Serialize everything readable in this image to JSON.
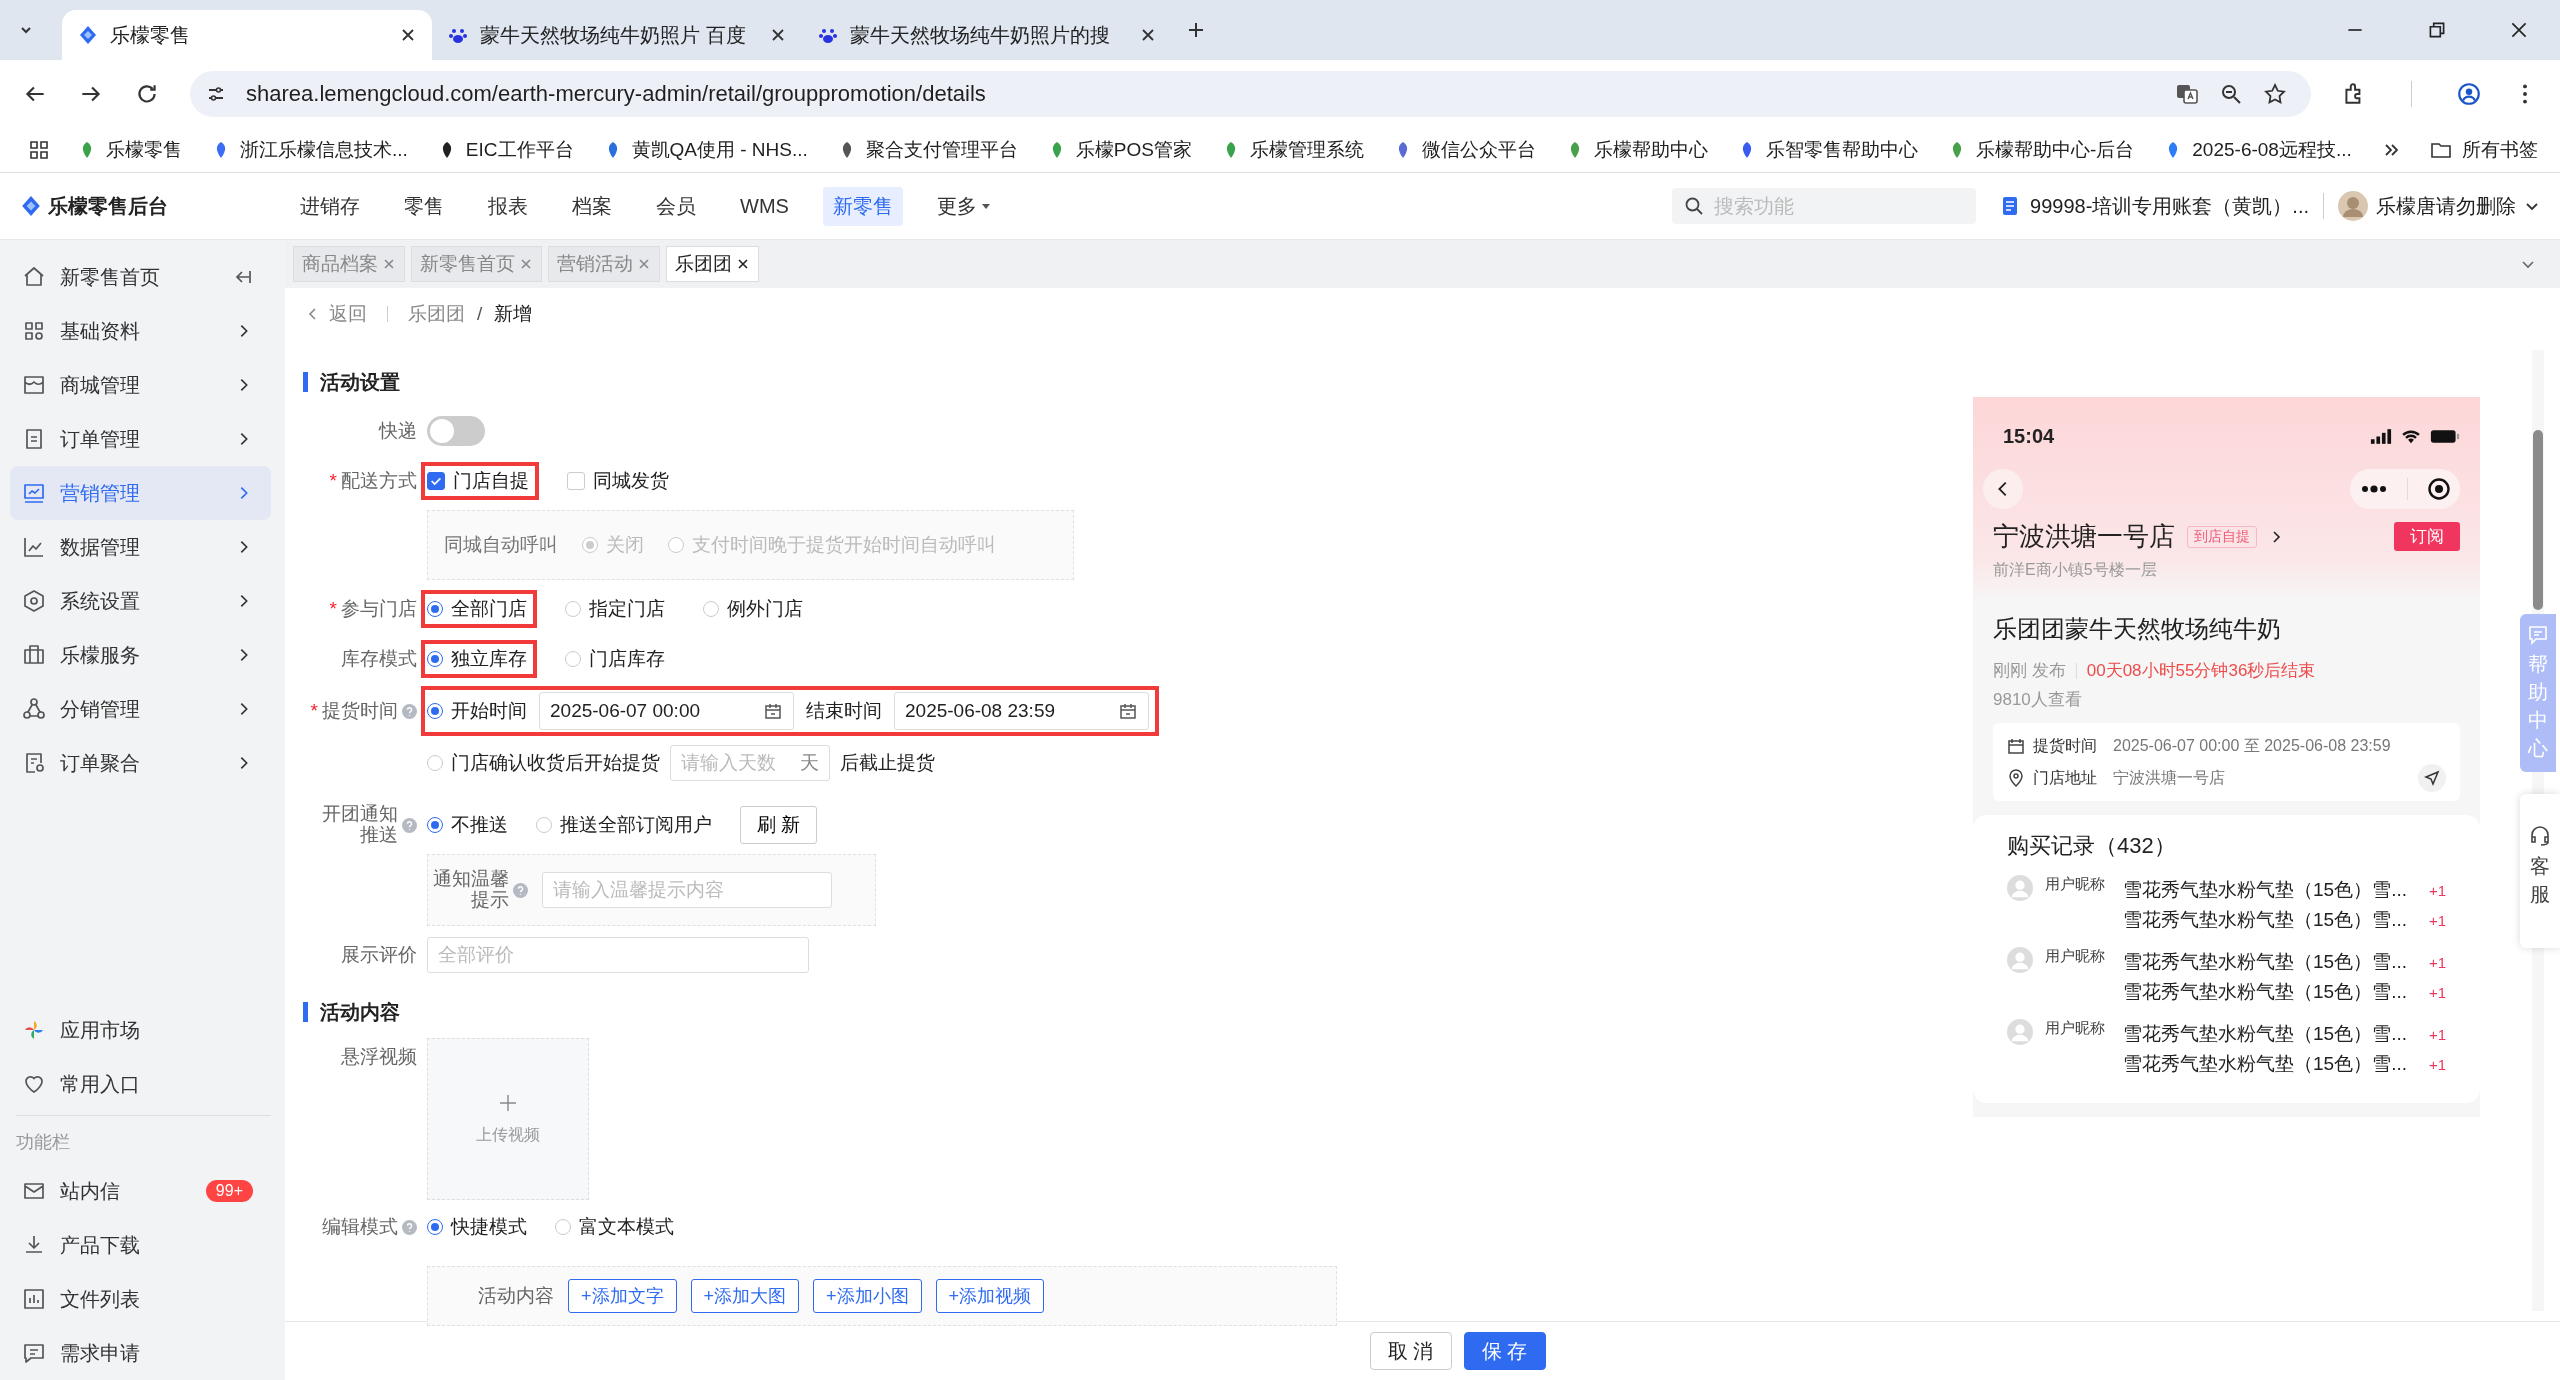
{
  "browser": {
    "tabs": [
      {
        "title": "乐檬零售",
        "selected": true
      },
      {
        "title": "蒙牛天然牧场纯牛奶照片 百度",
        "selected": false
      },
      {
        "title": "蒙牛天然牧场纯牛奶照片的搜",
        "selected": false
      }
    ],
    "url": "sharea.lemengcloud.com/earth-mercury-admin/retail/grouppromotion/details",
    "bookmarks": [
      "乐檬零售",
      "浙江乐檬信息技术...",
      "EIC工作平台",
      "黄凯QA使用 - NHS...",
      "聚合支付管理平台",
      "乐檬POS管家",
      "乐檬管理系统",
      "微信公众平台",
      "乐檬帮助中心",
      "乐智零售帮助中心",
      "乐檬帮助中心-后台",
      "2025-6-08远程技..."
    ],
    "all_bookmarks": "所有书签"
  },
  "app": {
    "brand": "乐檬零售后台",
    "nav": [
      {
        "label": "进销存",
        "selected": false
      },
      {
        "label": "零售",
        "selected": false
      },
      {
        "label": "报表",
        "selected": false
      },
      {
        "label": "档案",
        "selected": false
      },
      {
        "label": "会员",
        "selected": false
      },
      {
        "label": "WMS",
        "selected": false
      },
      {
        "label": "新零售",
        "selected": true
      },
      {
        "label": "更多",
        "selected": false
      }
    ],
    "search_placeholder": "搜索功能",
    "account": "99998-培训专用账套（黄凯）...",
    "user": "乐檬唐请勿删除"
  },
  "sidebar": {
    "items": [
      {
        "label": "新零售首页",
        "selected": false
      },
      {
        "label": "基础资料",
        "selected": false
      },
      {
        "label": "商城管理",
        "selected": false
      },
      {
        "label": "订单管理",
        "selected": false
      },
      {
        "label": "营销管理",
        "selected": true
      },
      {
        "label": "数据管理",
        "selected": false
      },
      {
        "label": "系统设置",
        "selected": false
      },
      {
        "label": "乐檬服务",
        "selected": false
      },
      {
        "label": "分销管理",
        "selected": false
      },
      {
        "label": "订单聚合",
        "selected": false
      }
    ],
    "shortcuts": [
      "应用市场",
      "常用入口"
    ],
    "section": "功能栏",
    "tools": [
      {
        "label": "站内信",
        "badge": "99+"
      },
      {
        "label": "产品下载"
      },
      {
        "label": "文件列表"
      },
      {
        "label": "需求申请"
      }
    ]
  },
  "page_tabs": [
    {
      "label": "商品档案",
      "selected": false
    },
    {
      "label": "新零售首页",
      "selected": false
    },
    {
      "label": "营销活动",
      "selected": false
    },
    {
      "label": "乐团团",
      "selected": true
    }
  ],
  "breadcrumb": {
    "back": "返回",
    "path": [
      "乐团团",
      "新增"
    ],
    "separator": "/"
  },
  "settings": {
    "title": "活动设置",
    "express": {
      "label": "快递",
      "on": false
    },
    "delivery": {
      "label": "配送方式",
      "mark": "*",
      "options": [
        {
          "label": "门店自提",
          "checked": true,
          "highlighted": true
        },
        {
          "label": "同城发货",
          "checked": false,
          "highlighted": false
        }
      ],
      "sub": {
        "label": "同城自动呼叫",
        "disabled": true,
        "options": [
          {
            "label": "关闭",
            "selected": true
          },
          {
            "label": "支付时间晚于提货开始时间自动呼叫",
            "selected": false
          }
        ]
      }
    },
    "stores": {
      "label": "参与门店",
      "mark": "*",
      "options": [
        {
          "label": "全部门店",
          "selected": true,
          "highlighted": true
        },
        {
          "label": "指定门店",
          "selected": false,
          "highlighted": false
        },
        {
          "label": "例外门店",
          "selected": false,
          "highlighted": false
        }
      ]
    },
    "stock": {
      "label": "库存模式",
      "options": [
        {
          "label": "独立库存",
          "selected": true,
          "highlighted": true
        },
        {
          "label": "门店库存",
          "selected": false,
          "highlighted": false
        }
      ]
    },
    "pickup": {
      "label": "提货时间",
      "mark": "*",
      "range": {
        "selected": true,
        "highlighted": true,
        "start_label": "开始时间",
        "start": "2025-06-07 00:00",
        "end_label": "结束时间",
        "end": "2025-06-08 23:59"
      },
      "days": {
        "selected": false,
        "label": "门店确认收货后开始提货",
        "placeholder": "请输入天数",
        "unit": "天",
        "suffix": "后截止提货"
      }
    },
    "notify": {
      "label": "开团通知推送",
      "options": [
        {
          "label": "不推送",
          "selected": true
        },
        {
          "label": "推送全部订阅用户",
          "selected": false
        }
      ],
      "button": "刷 新",
      "tip_label": "通知温馨提示",
      "tip_placeholder": "请输入温馨提示内容"
    },
    "review": {
      "label": "展示评价",
      "placeholder": "全部评价"
    }
  },
  "content": {
    "title": "活动内容",
    "video_label": "悬浮视频",
    "upload": "上传视频",
    "edit_mode": {
      "label": "编辑模式",
      "options": [
        {
          "label": "快捷模式",
          "selected": true
        },
        {
          "label": "富文本模式",
          "selected": false
        }
      ]
    },
    "blocks_label": "活动内容",
    "add_buttons": [
      "+添加文字",
      "+添加大图",
      "+添加小图",
      "+添加视频"
    ]
  },
  "footer": [
    {
      "label": "取 消",
      "kind": "default"
    },
    {
      "label": "保 存",
      "kind": "primary"
    }
  ],
  "preview": {
    "time": "15:04",
    "store": "宁波洪塘一号店",
    "store_tag": "到店自提",
    "subscribe": "订阅",
    "address": "前洋E商小镇5号楼一层",
    "title": "乐团团蒙牛天然牧场纯牛奶",
    "published": "刚刚 发布",
    "countdown": "00天08小时55分钟36秒后结束",
    "views": "9810人查看",
    "pickup_label": "提货时间",
    "pickup_value": "2025-06-07 00:00 至 2025-06-08 23:59",
    "address_label": "门店地址",
    "address_value": "宁波洪塘一号店",
    "records_title": "购买记录（432）",
    "records": [
      {
        "user": "用户昵称",
        "items": [
          {
            "name": "雪花秀气垫水粉气垫（15色）雪...",
            "qty": "+1"
          },
          {
            "name": "雪花秀气垫水粉气垫（15色）雪...",
            "qty": "+1"
          }
        ]
      },
      {
        "user": "用户昵称",
        "items": [
          {
            "name": "雪花秀气垫水粉气垫（15色）雪...",
            "qty": "+1"
          },
          {
            "name": "雪花秀气垫水粉气垫（15色）雪...",
            "qty": "+1"
          }
        ]
      },
      {
        "user": "用户昵称",
        "items": [
          {
            "name": "雪花秀气垫水粉气垫（15色）雪...",
            "qty": "+1"
          },
          {
            "name": "雪花秀气垫水粉气垫（15色）雪...",
            "qty": "+1"
          }
        ]
      }
    ]
  },
  "side_tabs": [
    "帮助中心",
    "客服"
  ]
}
